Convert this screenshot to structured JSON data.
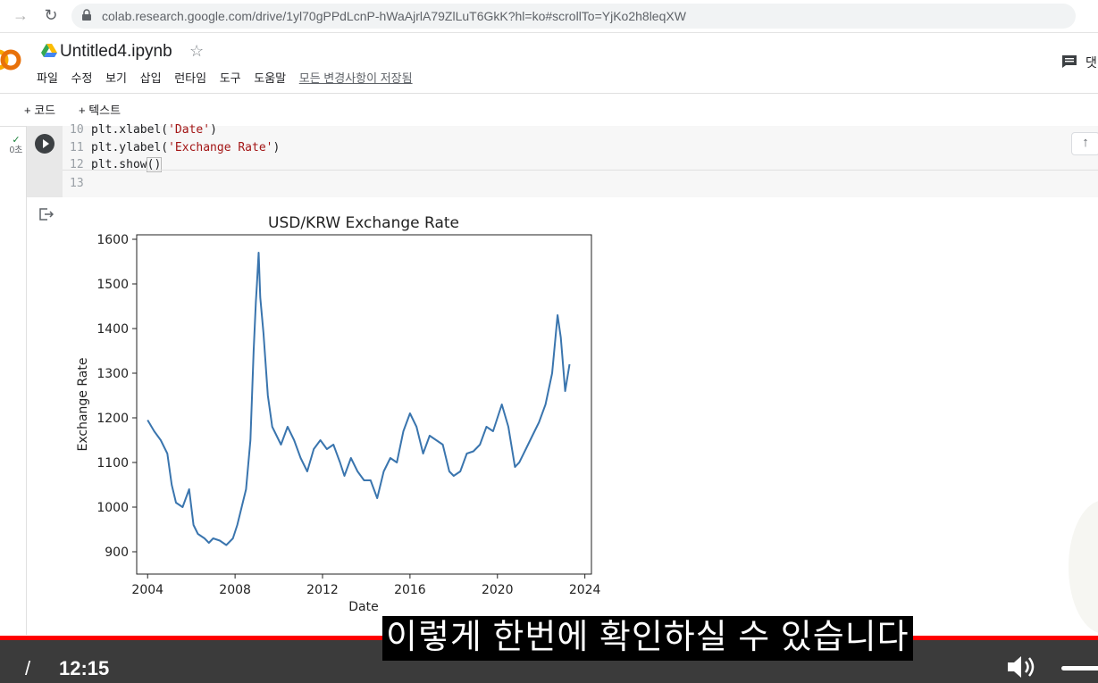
{
  "browser": {
    "url": "colab.research.google.com/drive/1yl70gPPdLcnP-hWaAjrlA79ZlLuT6GkK?hl=ko#scrollTo=YjKo2h8leqXW"
  },
  "notebook": {
    "title": "Untitled4.ipynb",
    "menu": [
      "파일",
      "수정",
      "보기",
      "삽입",
      "런타임",
      "도구",
      "도움말"
    ],
    "saved_status": "모든 변경사항이 저장됨",
    "comment_label": "댓"
  },
  "toolbar": {
    "add_code": "+ 코드",
    "add_text": "+ 텍스트"
  },
  "cell": {
    "status_check": "✓",
    "exec_time": "0초",
    "lines": [
      {
        "n": "10",
        "pre": "plt.xlabel(",
        "str": "'Date'",
        "post": ")"
      },
      {
        "n": "11",
        "pre": "plt.ylabel(",
        "str": "'Exchange Rate'",
        "post": ")"
      },
      {
        "n": "12",
        "pre": "plt.show",
        "paren": "()"
      },
      {
        "n": "13"
      }
    ]
  },
  "chart_data": {
    "type": "line",
    "title": "USD/KRW Exchange Rate",
    "xlabel": "Date",
    "ylabel": "Exchange Rate",
    "xlim": [
      2003.5,
      2024.3
    ],
    "ylim": [
      850,
      1610
    ],
    "xticks": [
      2004,
      2008,
      2012,
      2016,
      2020,
      2024
    ],
    "yticks": [
      900,
      1000,
      1100,
      1200,
      1300,
      1400,
      1500,
      1600
    ],
    "line_color": "#3a75ae",
    "series": [
      {
        "x": [
          2004.0,
          2004.3,
          2004.6,
          2004.9,
          2005.1,
          2005.3,
          2005.6,
          2005.9,
          2006.1,
          2006.3,
          2006.6,
          2006.8,
          2007.0,
          2007.3,
          2007.6,
          2007.9,
          2008.1,
          2008.3,
          2008.5,
          2008.7,
          2008.85,
          2008.95,
          2009.0,
          2009.08,
          2009.15,
          2009.3,
          2009.5,
          2009.7,
          2009.9,
          2010.1,
          2010.4,
          2010.7,
          2011.0,
          2011.3,
          2011.6,
          2011.9,
          2012.2,
          2012.5,
          2012.8,
          2013.0,
          2013.3,
          2013.6,
          2013.9,
          2014.2,
          2014.5,
          2014.8,
          2015.1,
          2015.4,
          2015.7,
          2016.0,
          2016.3,
          2016.6,
          2016.9,
          2017.2,
          2017.5,
          2017.8,
          2018.0,
          2018.3,
          2018.6,
          2018.9,
          2019.2,
          2019.5,
          2019.8,
          2020.0,
          2020.2,
          2020.5,
          2020.8,
          2021.0,
          2021.3,
          2021.6,
          2021.9,
          2022.2,
          2022.5,
          2022.75,
          2022.9,
          2023.1,
          2023.3
        ],
        "y": [
          1195,
          1170,
          1150,
          1120,
          1050,
          1010,
          1000,
          1040,
          960,
          940,
          930,
          920,
          930,
          925,
          915,
          930,
          960,
          1000,
          1040,
          1150,
          1350,
          1460,
          1500,
          1570,
          1470,
          1390,
          1250,
          1180,
          1160,
          1140,
          1180,
          1150,
          1110,
          1080,
          1130,
          1150,
          1130,
          1140,
          1100,
          1070,
          1110,
          1080,
          1060,
          1060,
          1020,
          1080,
          1110,
          1100,
          1170,
          1210,
          1180,
          1120,
          1160,
          1150,
          1140,
          1080,
          1070,
          1080,
          1120,
          1125,
          1140,
          1180,
          1170,
          1200,
          1230,
          1180,
          1090,
          1100,
          1130,
          1160,
          1190,
          1230,
          1300,
          1430,
          1380,
          1260,
          1320
        ]
      }
    ]
  },
  "player": {
    "time_left": "/",
    "time": "12:15",
    "subtitle": "이렇게 한번에 확인하실 수 있습니다"
  }
}
